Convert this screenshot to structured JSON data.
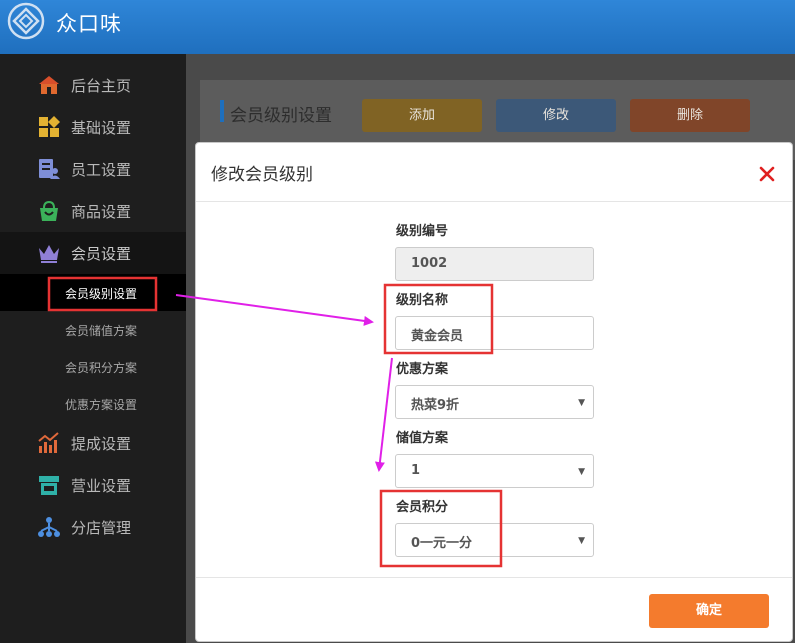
{
  "app": {
    "title": "众口味"
  },
  "sidebar": {
    "items": [
      {
        "label": "后台主页",
        "icon": "home-icon"
      },
      {
        "label": "基础设置",
        "icon": "blocks-icon"
      },
      {
        "label": "员工设置",
        "icon": "staff-icon"
      },
      {
        "label": "商品设置",
        "icon": "bag-icon"
      },
      {
        "label": "会员设置",
        "icon": "crown-icon"
      },
      {
        "label": "提成设置",
        "icon": "chart-icon"
      },
      {
        "label": "营业设置",
        "icon": "store-icon"
      },
      {
        "label": "分店管理",
        "icon": "branch-icon"
      }
    ],
    "sub_items": [
      {
        "label": "会员级别设置"
      },
      {
        "label": "会员储值方案"
      },
      {
        "label": "会员积分方案"
      },
      {
        "label": "优惠方案设置"
      }
    ]
  },
  "panel": {
    "title": "会员级别设置",
    "add_label": "添加",
    "edit_label": "修改",
    "delete_label": "删除"
  },
  "modal": {
    "title": "修改会员级别",
    "fields": {
      "level_no": {
        "label": "级别编号",
        "value": "1002"
      },
      "level_name": {
        "label": "级别名称",
        "value": "黄金会员"
      },
      "discount": {
        "label": "优惠方案",
        "value": "热菜9折"
      },
      "stored_value": {
        "label": "储值方案",
        "value": "1"
      },
      "points": {
        "label": "会员积分",
        "value": "0一元一分"
      }
    },
    "confirm_label": "确定"
  },
  "colors": {
    "header": "#2878c7",
    "sidebar": "#1e1e1e",
    "highlight": "#e53333",
    "arrow": "#e020e8",
    "confirm": "#f47b2d"
  }
}
